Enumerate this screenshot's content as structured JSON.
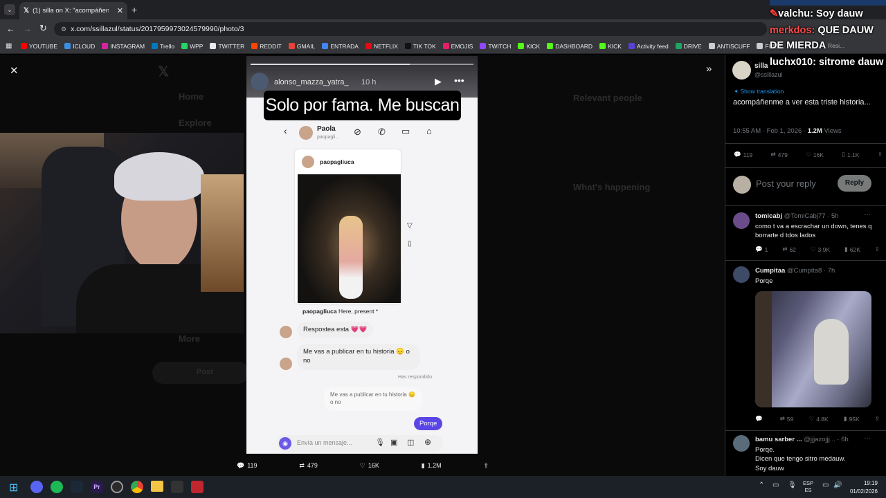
{
  "browser": {
    "tab_title": "(1) silla on X: \"acompáñenme a",
    "url": "x.com/ssillazul/status/2017959973024579990/photo/3",
    "bookmarks": [
      {
        "label": "YOUTUBE",
        "color": "#ff0000"
      },
      {
        "label": "ICLOUD",
        "color": "#3a8ee6"
      },
      {
        "label": "INSTAGRAM",
        "color": "#d6249f"
      },
      {
        "label": "Trello",
        "color": "#0079bf"
      },
      {
        "label": "WPP",
        "color": "#25d366"
      },
      {
        "label": "TWITTER",
        "color": "#e7e9ea"
      },
      {
        "label": "REDDIT",
        "color": "#ff4500"
      },
      {
        "label": "GMAIL",
        "color": "#ea4335"
      },
      {
        "label": "ENTRADA",
        "color": "#4285f4"
      },
      {
        "label": "NETFLIX",
        "color": "#e50914"
      },
      {
        "label": "TIK TOK",
        "color": "#111111"
      },
      {
        "label": "EMOJIS",
        "color": "#e81e63"
      },
      {
        "label": "TWITCH",
        "color": "#9146ff"
      },
      {
        "label": "KICK",
        "color": "#53fc18"
      },
      {
        "label": "DASHBOARD",
        "color": "#53fc18"
      },
      {
        "label": "KICK",
        "color": "#53fc18"
      },
      {
        "label": "Activity feed",
        "color": "#5a3fd9"
      },
      {
        "label": "DRIVE",
        "color": "#1fa463"
      },
      {
        "label": "ANTISCUFF",
        "color": "#cccccc"
      },
      {
        "label": "FUEN",
        "color": "#cccccc"
      }
    ],
    "resi": "Resi..."
  },
  "stream_chat": [
    {
      "user": "valchu:",
      "text": "Soy dauw",
      "color": "#ffffff"
    },
    {
      "user": "merkdos:",
      "text": "QUE DAUW DE MIERDA",
      "color": "#ff5a5a"
    },
    {
      "user": "luchx010:",
      "text": "sitrome dauw",
      "color": "#ffffff"
    }
  ],
  "story": {
    "username": "alonso_mazza_yatra_",
    "time": "10 h",
    "caption": "Solo por fama. Me buscan",
    "dm_name": "Paola",
    "dm_handle": "paopagli...",
    "post_user": "paopagliuca",
    "post_caption_user": "paopagliuca",
    "post_caption": "Here, present *",
    "msg1": "Respostea esta 💗💗",
    "msg2": "Me vas a publicar en tu historia 😞 o no",
    "replied_label": "Has respondido",
    "quoted": "Me vas a publicar en tu historia 😞 o no",
    "my_msg": "Porqe",
    "input_placeholder": "Envía un mensaje..."
  },
  "photo_actions": {
    "replies": "119",
    "reposts": "479",
    "likes": "16K",
    "views": "1.2M"
  },
  "ghost_nav": {
    "home": "Home",
    "explore": "Explore",
    "more": "More",
    "post": "Post",
    "relevant": "Relevant people",
    "happening": "What's happening"
  },
  "tweet": {
    "author": "silla",
    "handle": "@ssillazul",
    "show_translation": "Show translation",
    "text": "acompáñenme a ver esta triste historia...",
    "timestamp": "10:55 AM · Feb 1, 2026 · ",
    "views_count": "1.2M",
    "views_label": " Views",
    "replies": "119",
    "reposts": "479",
    "likes": "16K",
    "bookmarks": "1.1K"
  },
  "reply_box": {
    "placeholder": "Post your reply",
    "button": "Reply"
  },
  "replies": [
    {
      "name": "tomicabj",
      "handle": "@TomiCabj77 · 5h",
      "text": "como t va a escrachar un down, tenes q borrarte d tdos lados",
      "replies": "1",
      "reposts": "62",
      "likes": "3.9K",
      "views": "62K"
    },
    {
      "name": "Cumpitaa",
      "handle": "@Cumpita8 · 7h",
      "text": "Porqe",
      "replies": "",
      "reposts": "59",
      "likes": "4.8K",
      "views": "95K"
    },
    {
      "name": "bamu sarber ...",
      "handle": "@jjjazojjj... · 6h",
      "text": "Porqe.\nDicen que tengo sitro medauw.\nSoy dauw"
    }
  ],
  "taskbar": {
    "lang_top": "ESP",
    "lang_bottom": "ES",
    "time": "19:19",
    "date": "01/02/2026"
  }
}
